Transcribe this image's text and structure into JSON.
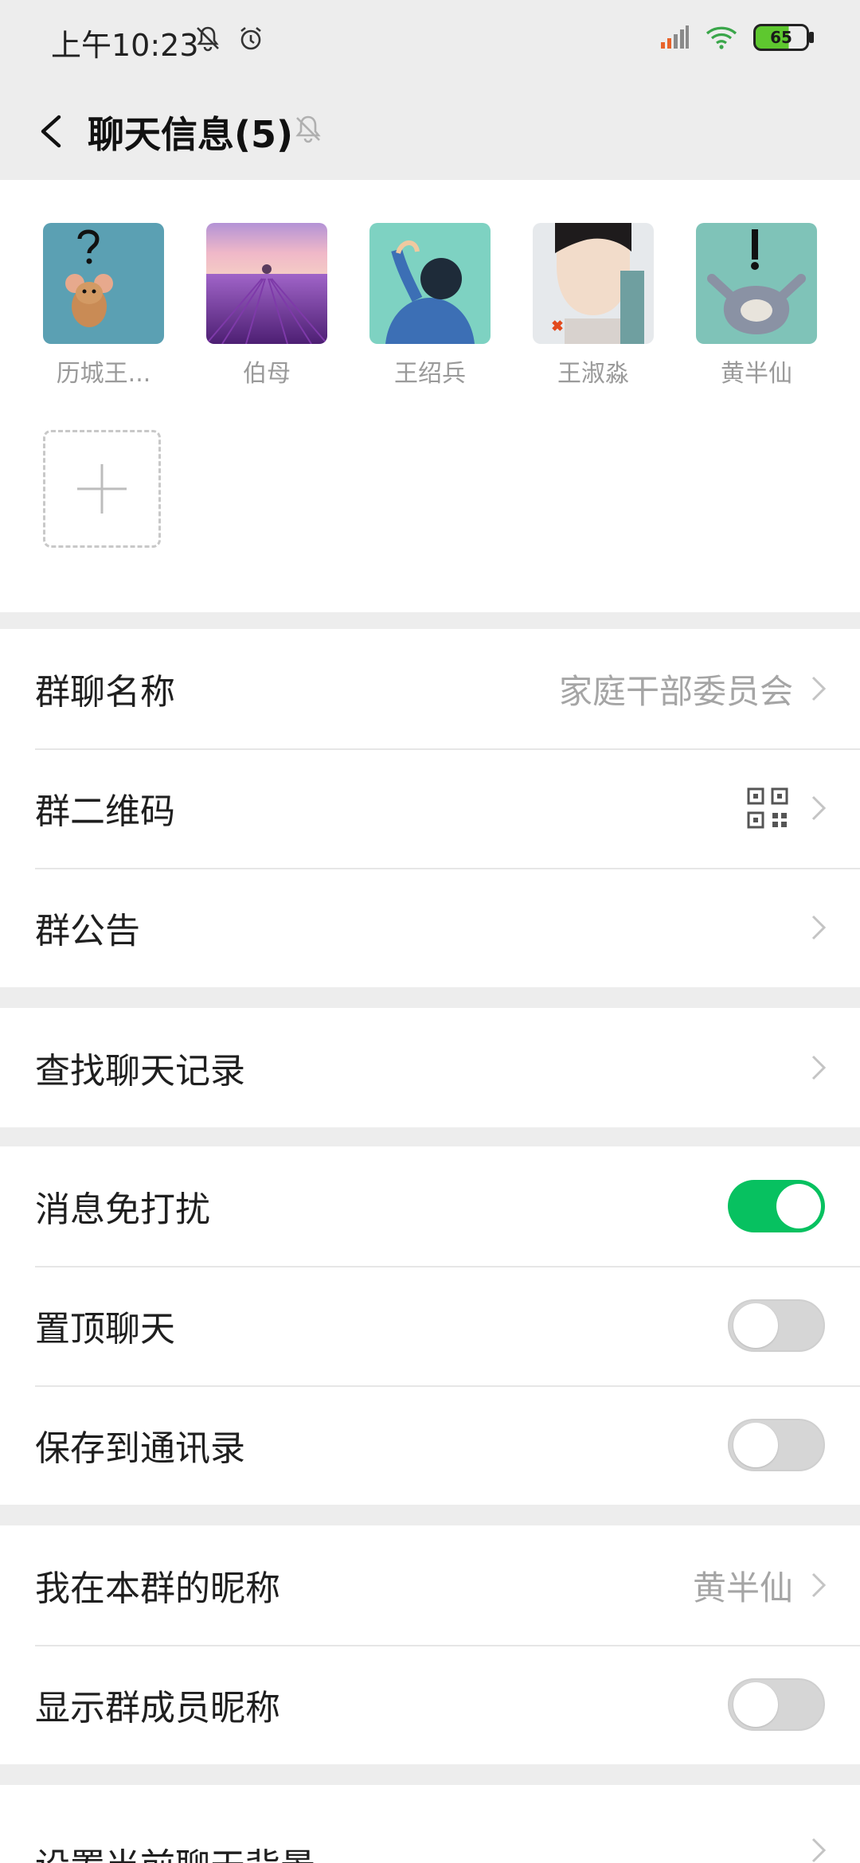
{
  "status_bar": {
    "time": "上午10:23",
    "battery": "65"
  },
  "nav": {
    "title": "聊天信息(5)"
  },
  "members": [
    {
      "name": "历城王...",
      "avatar": "jerry-question-avatar"
    },
    {
      "name": "伯母",
      "avatar": "lavender-field-avatar"
    },
    {
      "name": "王绍兵",
      "avatar": "cartoon-man-avatar"
    },
    {
      "name": "王淑淼",
      "avatar": "actor-photo-avatar"
    },
    {
      "name": "黄半仙",
      "avatar": "tom-exclaim-avatar"
    }
  ],
  "section1": {
    "group_name_label": "群聊名称",
    "group_name_value": "家庭干部委员会",
    "qr_label": "群二维码",
    "notice_label": "群公告"
  },
  "section2": {
    "search_label": "查找聊天记录"
  },
  "section3": {
    "mute_label": "消息免打扰",
    "mute_on": true,
    "pin_label": "置顶聊天",
    "pin_on": false,
    "save_label": "保存到通讯录",
    "save_on": false
  },
  "section4": {
    "nickname_label": "我在本群的昵称",
    "nickname_value": "黄半仙",
    "show_nick_label": "显示群成员昵称",
    "show_nick_on": false
  },
  "section5": {
    "background_label": "设置当前聊天背景"
  },
  "colors": {
    "accent": "#07c160",
    "background": "#ededed"
  }
}
